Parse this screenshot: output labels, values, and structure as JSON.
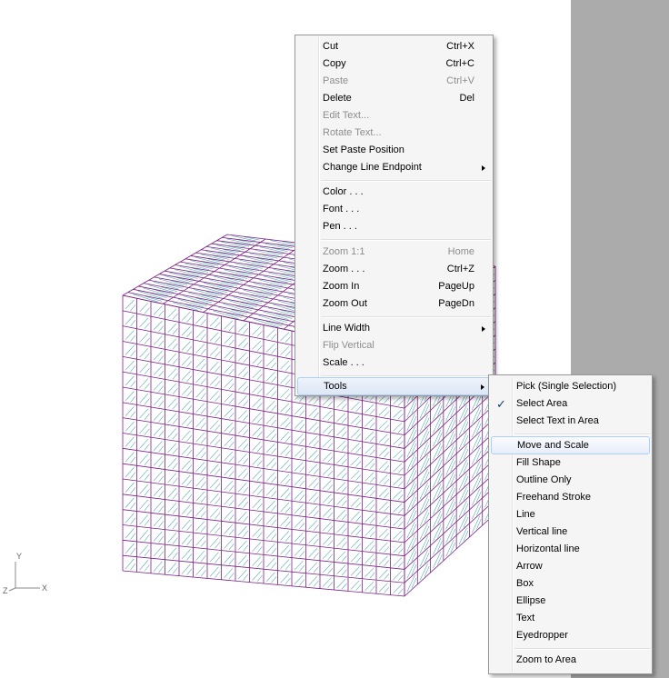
{
  "axes": {
    "y": "Y",
    "x": "X",
    "z": "Z"
  },
  "context_menu": {
    "items": [
      {
        "label": "Cut",
        "shortcut": "Ctrl+X",
        "enabled": true
      },
      {
        "label": "Copy",
        "shortcut": "Ctrl+C",
        "enabled": true
      },
      {
        "label": "Paste",
        "shortcut": "Ctrl+V",
        "enabled": false
      },
      {
        "label": "Delete",
        "shortcut": "Del",
        "enabled": true
      },
      {
        "label": "Edit Text...",
        "shortcut": "",
        "enabled": false
      },
      {
        "label": "Rotate Text...",
        "shortcut": "",
        "enabled": false
      },
      {
        "label": "Set Paste Position",
        "shortcut": "",
        "enabled": true
      },
      {
        "label": "Change Line Endpoint",
        "shortcut": "",
        "enabled": true,
        "submenu": true
      },
      {
        "label": "Color . . .",
        "shortcut": "",
        "enabled": true
      },
      {
        "label": "Font . . .",
        "shortcut": "",
        "enabled": true
      },
      {
        "label": "Pen . . .",
        "shortcut": "",
        "enabled": true
      },
      {
        "label": "Zoom 1:1",
        "shortcut": "Home",
        "enabled": false
      },
      {
        "label": "Zoom . . .",
        "shortcut": "Ctrl+Z",
        "enabled": true
      },
      {
        "label": "Zoom In",
        "shortcut": "PageUp",
        "enabled": true
      },
      {
        "label": "Zoom Out",
        "shortcut": "PageDn",
        "enabled": true
      },
      {
        "label": "Line Width",
        "shortcut": "",
        "enabled": true,
        "submenu": true
      },
      {
        "label": "Flip Vertical",
        "shortcut": "",
        "enabled": false
      },
      {
        "label": "Scale . . .",
        "shortcut": "",
        "enabled": true
      },
      {
        "label": "Tools",
        "shortcut": "",
        "enabled": true,
        "submenu": true
      }
    ]
  },
  "tools_submenu": {
    "items": [
      {
        "label": "Pick (Single Selection)",
        "checked": false
      },
      {
        "label": "Select Area",
        "checked": true
      },
      {
        "label": "Select Text in Area",
        "checked": false
      },
      {
        "label": "Move and Scale",
        "checked": false
      },
      {
        "label": "Fill Shape",
        "checked": false
      },
      {
        "label": "Outline Only",
        "checked": false
      },
      {
        "label": "Freehand Stroke",
        "checked": false
      },
      {
        "label": "Line",
        "checked": false
      },
      {
        "label": "Vertical line",
        "checked": false
      },
      {
        "label": "Horizontal line",
        "checked": false
      },
      {
        "label": "Arrow",
        "checked": false
      },
      {
        "label": "Box",
        "checked": false
      },
      {
        "label": "Ellipse",
        "checked": false
      },
      {
        "label": "Text",
        "checked": false
      },
      {
        "label": "Eyedropper",
        "checked": false
      },
      {
        "label": "Zoom to Area",
        "checked": false
      }
    ]
  },
  "colors": {
    "mesh_line": "#7a1f86",
    "mesh_hatch": "#5aa8b8",
    "scrollbar": "#ababab",
    "menu_bg": "#f5f5f5"
  }
}
